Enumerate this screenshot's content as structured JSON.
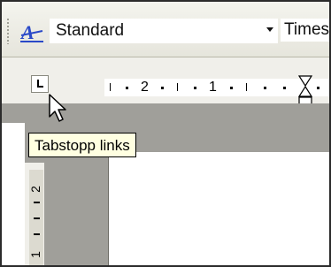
{
  "toolbar": {
    "style_icon": "style-a-icon",
    "style_value": "Standard",
    "font_value": "Times"
  },
  "ruler": {
    "tab_selector_icon": "left-tab-icon",
    "labels": [
      "2",
      "1"
    ]
  },
  "vertical_ruler": {
    "labels": [
      "2",
      "1"
    ]
  },
  "tooltip": {
    "text": "Tabstopp links"
  },
  "cursor": {
    "icon": "arrow-cursor-icon"
  },
  "colors": {
    "toolbar_bg": "#ebeae2",
    "ruler_bg": "#f0efea",
    "workspace_gray": "#a09f9a",
    "tooltip_bg": "#ffffe1",
    "style_icon_blue": "#2a49c8"
  }
}
